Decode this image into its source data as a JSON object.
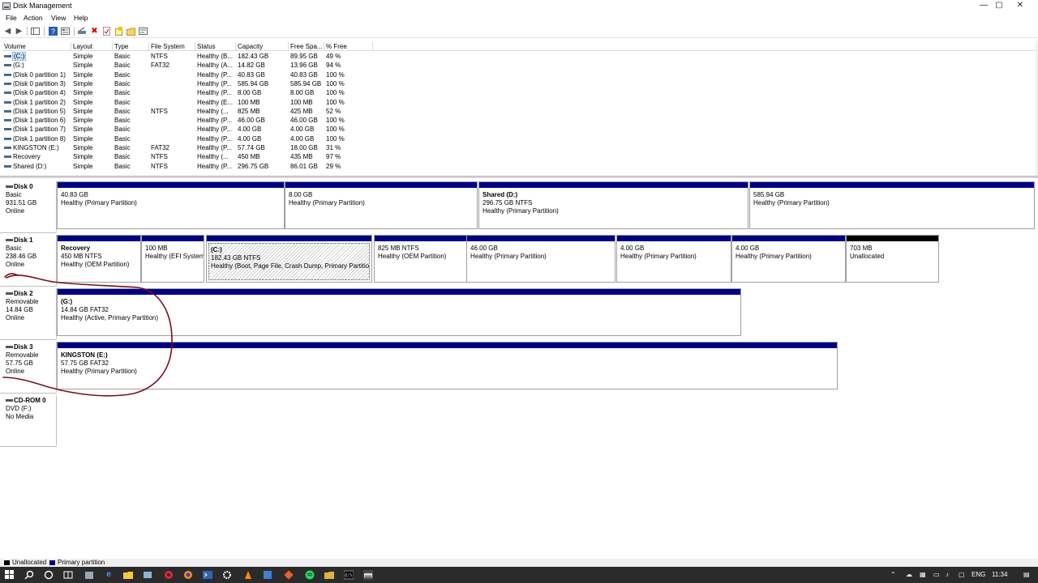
{
  "window": {
    "title": "Disk Management",
    "min": "—",
    "max": "▢",
    "close": "✕"
  },
  "menu": [
    "File",
    "Action",
    "View",
    "Help"
  ],
  "columns": [
    "Volume",
    "Layout",
    "Type",
    "File System",
    "Status",
    "Capacity",
    "Free Spa...",
    "% Free"
  ],
  "volumes": [
    [
      "(C:)",
      "Simple",
      "Basic",
      "NTFS",
      "Healthy (B...",
      "182.43 GB",
      "89.95 GB",
      "49 %"
    ],
    [
      "(G:)",
      "Simple",
      "Basic",
      "FAT32",
      "Healthy (A...",
      "14.82 GB",
      "13.96 GB",
      "94 %"
    ],
    [
      "(Disk 0 partition 1)",
      "Simple",
      "Basic",
      "",
      "Healthy (P...",
      "40.83 GB",
      "40.83 GB",
      "100 %"
    ],
    [
      "(Disk 0 partition 3)",
      "Simple",
      "Basic",
      "",
      "Healthy (P...",
      "585.94 GB",
      "585.94 GB",
      "100 %"
    ],
    [
      "(Disk 0 partition 4)",
      "Simple",
      "Basic",
      "",
      "Healthy (P...",
      "8.00 GB",
      "8.00 GB",
      "100 %"
    ],
    [
      "(Disk 1 partition 2)",
      "Simple",
      "Basic",
      "",
      "Healthy (E...",
      "100 MB",
      "100 MB",
      "100 %"
    ],
    [
      "(Disk 1 partition 5)",
      "Simple",
      "Basic",
      "NTFS",
      "Healthy (...",
      "825 MB",
      "425 MB",
      "52 %"
    ],
    [
      "(Disk 1 partition 6)",
      "Simple",
      "Basic",
      "",
      "Healthy (P...",
      "46.00 GB",
      "46.00 GB",
      "100 %"
    ],
    [
      "(Disk 1 partition 7)",
      "Simple",
      "Basic",
      "",
      "Healthy (P...",
      "4.00 GB",
      "4.00 GB",
      "100 %"
    ],
    [
      "(Disk 1 partition 8)",
      "Simple",
      "Basic",
      "",
      "Healthy (P...",
      "4.00 GB",
      "4.00 GB",
      "100 %"
    ],
    [
      "KINGSTON (E:)",
      "Simple",
      "Basic",
      "FAT32",
      "Healthy (P...",
      "57.74 GB",
      "18.00 GB",
      "31 %"
    ],
    [
      "Recovery",
      "Simple",
      "Basic",
      "NTFS",
      "Healthy (...",
      "450 MB",
      "435 MB",
      "97 %"
    ],
    [
      "Shared (D:)",
      "Simple",
      "Basic",
      "NTFS",
      "Healthy (P...",
      "296.75 GB",
      "86.01 GB",
      "29 %"
    ]
  ],
  "disks": [
    {
      "name": "Disk 0",
      "kind": "Basic",
      "size": "931.51 GB",
      "state": "Online",
      "partitions": [
        {
          "name": "",
          "size": "40.83 GB",
          "status": "Healthy (Primary Partition)"
        },
        {
          "name": "",
          "size": "8.00 GB",
          "status": "Healthy (Primary Partition)"
        },
        {
          "name": "Shared  (D:)",
          "size": "296.75 GB NTFS",
          "status": "Healthy (Primary Partition)"
        },
        {
          "name": "",
          "size": "585.94 GB",
          "status": "Healthy (Primary Partition)"
        }
      ]
    },
    {
      "name": "Disk 1",
      "kind": "Basic",
      "size": "238.46 GB",
      "state": "Online",
      "partitions": [
        {
          "name": "Recovery",
          "size": "450 MB NTFS",
          "status": "Healthy (OEM Partition)"
        },
        {
          "name": "",
          "size": "100 MB",
          "status": "Healthy (EFI System"
        },
        {
          "name": "(C:)",
          "size": "182.43 GB NTFS",
          "status": "Healthy (Boot, Page File, Crash Dump, Primary Partition)"
        },
        {
          "name": "",
          "size": "825 MB NTFS",
          "status": "Healthy (OEM Partition)"
        },
        {
          "name": "",
          "size": "46.00 GB",
          "status": "Healthy (Primary Partition)"
        },
        {
          "name": "",
          "size": "4.00 GB",
          "status": "Healthy (Primary Partition)"
        },
        {
          "name": "",
          "size": "4.00 GB",
          "status": "Healthy (Primary Partition)"
        },
        {
          "name": "",
          "size": "703 MB",
          "status": "Unallocated"
        }
      ]
    },
    {
      "name": "Disk 2",
      "kind": "Removable",
      "size": "14.84 GB",
      "state": "Online",
      "partitions": [
        {
          "name": "(G:)",
          "size": "14.84 GB FAT32",
          "status": "Healthy (Active, Primary Partition)"
        }
      ]
    },
    {
      "name": "Disk 3",
      "kind": "Removable",
      "size": "57.75 GB",
      "state": "Online",
      "partitions": [
        {
          "name": "KINGSTON  (E:)",
          "size": "57.75 GB FAT32",
          "status": "Healthy (Primary Partition)"
        }
      ]
    },
    {
      "name": "CD-ROM 0",
      "kind": "DVD (F:)",
      "size": "",
      "state": "No Media",
      "partitions": []
    }
  ],
  "legend": {
    "unallocated": "Unallocated",
    "primary": "Primary partition"
  },
  "colors": {
    "primary": "#000080",
    "unallocated": "#000000",
    "annotation": "#7a0f1c"
  },
  "taskbar": {
    "lang": "ENG",
    "time": "11:34"
  }
}
